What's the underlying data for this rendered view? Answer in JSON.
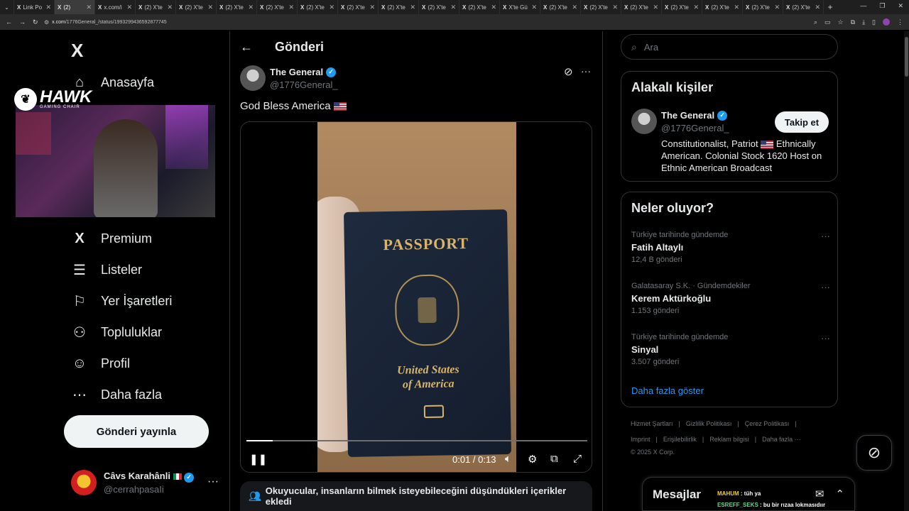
{
  "browser": {
    "tabs": [
      {
        "label": "Link Po"
      },
      {
        "label": "(2) ",
        "active": true
      },
      {
        "label": "x.com/i"
      },
      {
        "label": "(2) X'te"
      },
      {
        "label": "(2) X'te"
      },
      {
        "label": "(2) X'te"
      },
      {
        "label": "(2) X'te"
      },
      {
        "label": "(2) X'te"
      },
      {
        "label": "(2) X'te"
      },
      {
        "label": "(2) X'te"
      },
      {
        "label": "(2) X'te"
      },
      {
        "label": "(2) X'te"
      },
      {
        "label": "X'te Gü"
      },
      {
        "label": "(2) X'te"
      },
      {
        "label": "(2) X'te"
      },
      {
        "label": "(2) X'te"
      },
      {
        "label": "(2) X'te"
      },
      {
        "label": "(2) X'te"
      },
      {
        "label": "(2) X'te"
      },
      {
        "label": "(2) X'te"
      }
    ],
    "url_host": "x.com",
    "url_path": "/1776General_/status/1993299436592877745"
  },
  "sidebar": {
    "logo": "X",
    "items": [
      {
        "label": "Anasayfa",
        "icon": "home-icon"
      },
      {
        "label": "Premium",
        "icon": "x-icon"
      },
      {
        "label": "Listeler",
        "icon": "list-icon"
      },
      {
        "label": "Yer İşaretleri",
        "icon": "bookmark-icon"
      },
      {
        "label": "Topluluklar",
        "icon": "communities-icon"
      },
      {
        "label": "Profil",
        "icon": "profile-icon"
      },
      {
        "label": "Daha fazla",
        "icon": "more-circle-icon"
      }
    ],
    "post_button": "Gönderi yayınla",
    "account": {
      "name": "Câvs Karahânli",
      "handle": "@cerrahpasaIi"
    }
  },
  "webcam": {
    "brand": "HAWK",
    "brand_sub": "GAMING CHAIR"
  },
  "main": {
    "title": "Gönderi",
    "tweet": {
      "author": "The General",
      "handle": "@1776General_",
      "text": "God Bless America",
      "video": {
        "passport_title": "PASSPORT",
        "passport_country_1": "United States",
        "passport_country_2": "of America",
        "time": "0:01 / 0:13",
        "progress": 0.077
      }
    },
    "community_note": "Okuyucular, insanların bilmek isteyebileceğini düşündükleri içerikler ekledi"
  },
  "right": {
    "search_placeholder": "Ara",
    "related": {
      "title": "Alakalı kişiler",
      "name": "The General",
      "handle": "@1776General_",
      "follow": "Takip et",
      "bio_1": "Constitutionalist, Patriot",
      "bio_2": "Ethnically American. Colonial Stock 1620 Host on Ethnic American Broadcast"
    },
    "trends": {
      "title": "Neler oluyor?",
      "items": [
        {
          "context": "Türkiye tarihinde gündemde",
          "topic": "Fatih Altaylı",
          "count": "12,4 B gönderi"
        },
        {
          "context": "Galatasaray S.K. · Gündemdekiler",
          "topic": "Kerem Aktürkoğlu",
          "count": "1.153 gönderi"
        },
        {
          "context": "Türkiye tarihinde gündemde",
          "topic": "Sinyal",
          "count": "3.507 gönderi"
        }
      ],
      "show_more": "Daha fazla göster"
    },
    "footer": {
      "links_1": [
        "Hizmet Şartları",
        "|",
        "Gizlilik Politikası",
        "|",
        "Çerez Politikası",
        "|"
      ],
      "links_2": [
        "Imprint",
        "|",
        "Erişilebilirlik",
        "|",
        "Reklam bilgisi",
        "|",
        "Daha fazla ···"
      ],
      "copyright": "© 2025 X Corp."
    }
  },
  "messages": {
    "title": "Mesajlar",
    "chat": [
      {
        "user": "MAHUM",
        "text": ": tüh ya"
      },
      {
        "user": "ESREFF_SEKS",
        "text": ": bu bir rızaa lokmasıdıır"
      }
    ]
  },
  "colors": {
    "accent": "#1d9bf0",
    "background": "#000000",
    "border": "#2f3336"
  }
}
